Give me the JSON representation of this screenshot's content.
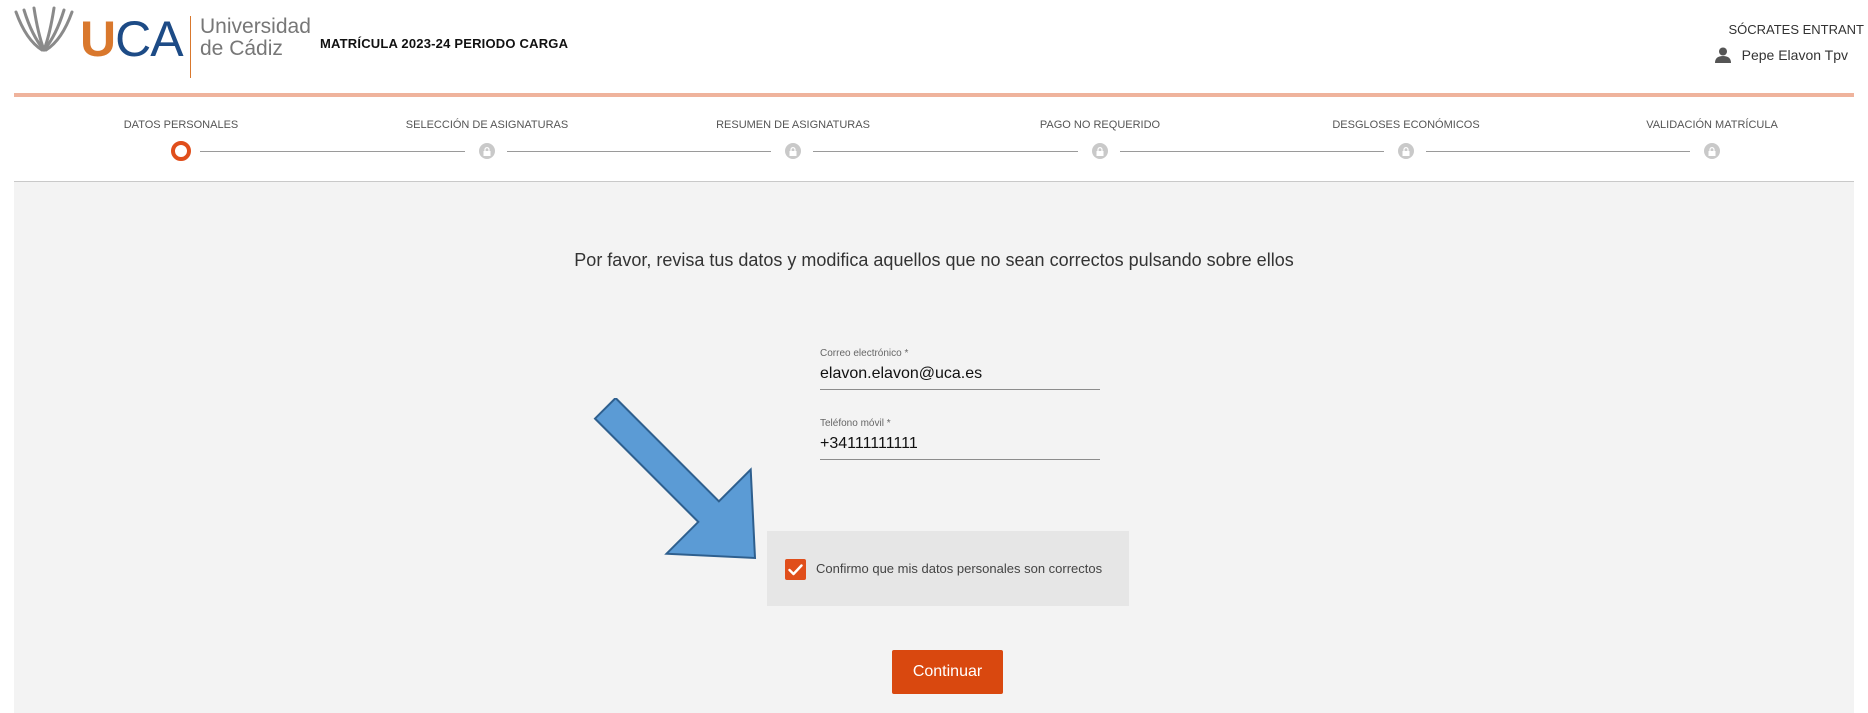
{
  "header": {
    "logo_letter_u": "U",
    "logo_letters_ca": "CA",
    "logo_line1": "Universidad",
    "logo_line2": "de Cádiz",
    "app_title": "MATRÍCULA 2023-24 PERIODO CARGA",
    "role": "SÓCRATES ENTRANT",
    "user_name": "Pepe Elavon Tpv",
    "user_icon": "person-icon"
  },
  "stepper": {
    "steps": [
      {
        "label": "DATOS PERSONALES",
        "state": "active"
      },
      {
        "label": "SELECCIÓN DE ASIGNATURAS",
        "state": "locked"
      },
      {
        "label": "RESUMEN DE ASIGNATURAS",
        "state": "locked"
      },
      {
        "label": "PAGO NO REQUERIDO",
        "state": "locked"
      },
      {
        "label": "DESGLOSES ECONÓMICOS",
        "state": "locked"
      },
      {
        "label": "VALIDACIÓN MATRÍCULA",
        "state": "locked"
      }
    ],
    "locked_icon": "lock-icon"
  },
  "main": {
    "instruction": "Por favor, revisa tus datos y modifica aquellos que no sean correctos pulsando sobre ellos",
    "email": {
      "label": "Correo electrónico *",
      "value": "elavon.elavon@uca.es"
    },
    "phone": {
      "label": "Teléfono móvil *",
      "value": "+34111111111"
    },
    "confirm": {
      "label": "Confirmo que mis datos personales son correctos",
      "checked": true
    },
    "continue_label": "Continuar"
  },
  "colors": {
    "accent": "#e04e1b",
    "button": "#d9480f",
    "logo_orange": "#d9782d",
    "logo_blue": "#1d4b86",
    "annotation_arrow": "#5b9bd5"
  }
}
